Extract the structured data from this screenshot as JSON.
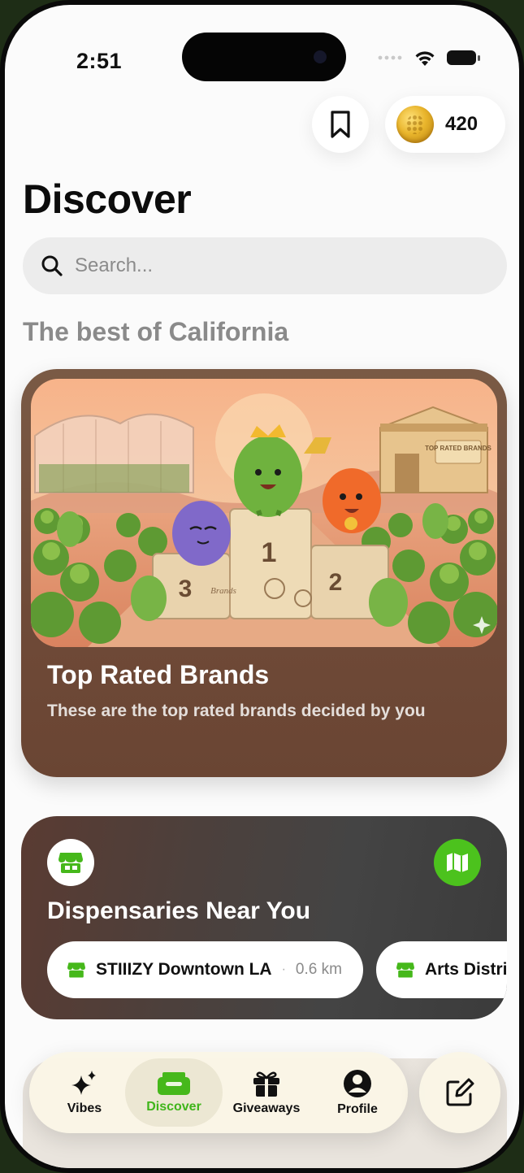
{
  "status_bar": {
    "time": "2:51"
  },
  "header": {
    "coins": "420"
  },
  "page": {
    "title": "Discover"
  },
  "search": {
    "placeholder": "Search..."
  },
  "section": {
    "title": "The best of California"
  },
  "brands_card": {
    "title": "Top Rated Brands",
    "subtitle": "These are the top rated brands decided by you",
    "art_labels": {
      "barn_sign": "TOP RATED BRANDS",
      "podium_sign": "Brands",
      "place_1": "1",
      "place_2": "2",
      "place_3": "3"
    }
  },
  "dispensaries": {
    "title": "Dispensaries Near You",
    "items": [
      {
        "name": "STIIIZY Downtown LA",
        "distance": "0.6 km"
      },
      {
        "name": "Arts District",
        "distance": ""
      }
    ]
  },
  "tabbar": {
    "tabs": [
      {
        "label": "Vibes",
        "icon": "sparkles-icon"
      },
      {
        "label": "Discover",
        "icon": "tray-icon",
        "active": true
      },
      {
        "label": "Giveaways",
        "icon": "gift-icon"
      },
      {
        "label": "Profile",
        "icon": "person-icon"
      }
    ]
  },
  "colors": {
    "accent_green": "#4cc21d",
    "card_brown": "#6f4a38",
    "card_dark": "#444444"
  }
}
